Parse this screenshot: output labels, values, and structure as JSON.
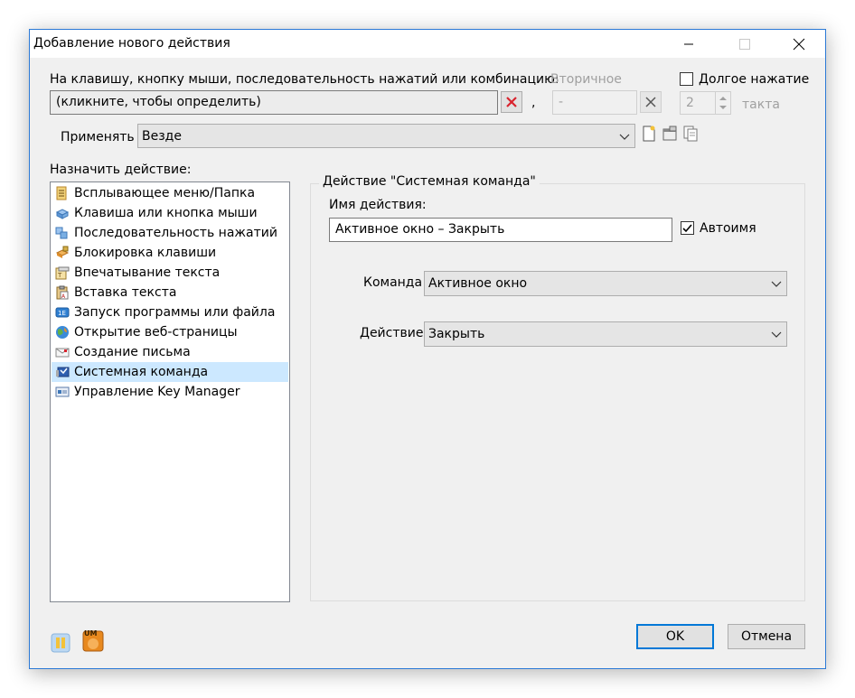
{
  "window": {
    "title": "Добавление нового действия"
  },
  "hotkey": {
    "label": "На клавишу, кнопку мыши, последовательность нажатий или комбинацию:",
    "primary_value": "(кликните, чтобы определить)",
    "separator": ",",
    "secondary_label": "Вторичное",
    "secondary_value": "-",
    "long_press_label": "Долгое нажатие",
    "long_press_checked": false,
    "ticks_value": "2",
    "ticks_label": "такта"
  },
  "apply": {
    "label": "Применять",
    "value": "Везде"
  },
  "assign": {
    "label": "Назначить действие:",
    "items": [
      {
        "label": "Всплывающее меню/Папка",
        "icon": "folder-menu-icon"
      },
      {
        "label": "Клавиша или кнопка мыши",
        "icon": "key-icon"
      },
      {
        "label": "Последовательность нажатий",
        "icon": "keys-sequence-icon"
      },
      {
        "label": "Блокировка клавиши",
        "icon": "key-lock-icon"
      },
      {
        "label": "Впечатывание текста",
        "icon": "type-text-icon"
      },
      {
        "label": "Вставка текста",
        "icon": "paste-text-icon"
      },
      {
        "label": "Запуск программы или файла",
        "icon": "run-program-icon"
      },
      {
        "label": "Открытие веб-страницы",
        "icon": "globe-icon"
      },
      {
        "label": "Создание письма",
        "icon": "envelope-icon"
      },
      {
        "label": "Системная команда",
        "icon": "system-command-icon"
      },
      {
        "label": "Управление Key Manager",
        "icon": "key-manager-icon"
      }
    ],
    "selected_index": 9
  },
  "action": {
    "group_title": "Действие \"Системная команда\"",
    "name_label": "Имя действия:",
    "name_value": "Активное окно – Закрыть",
    "autoname_label": "Автоимя",
    "autoname_checked": true,
    "command_label": "Команда",
    "command_value": "Активное окно",
    "action_label": "Действие",
    "action_value": "Закрыть"
  },
  "footer": {
    "ok_label": "OK",
    "cancel_label": "Отмена",
    "um_badge": "UM"
  },
  "colors": {
    "accent": "#0078d7",
    "selection": "#cce8ff",
    "clear_x": "#d9232d"
  }
}
